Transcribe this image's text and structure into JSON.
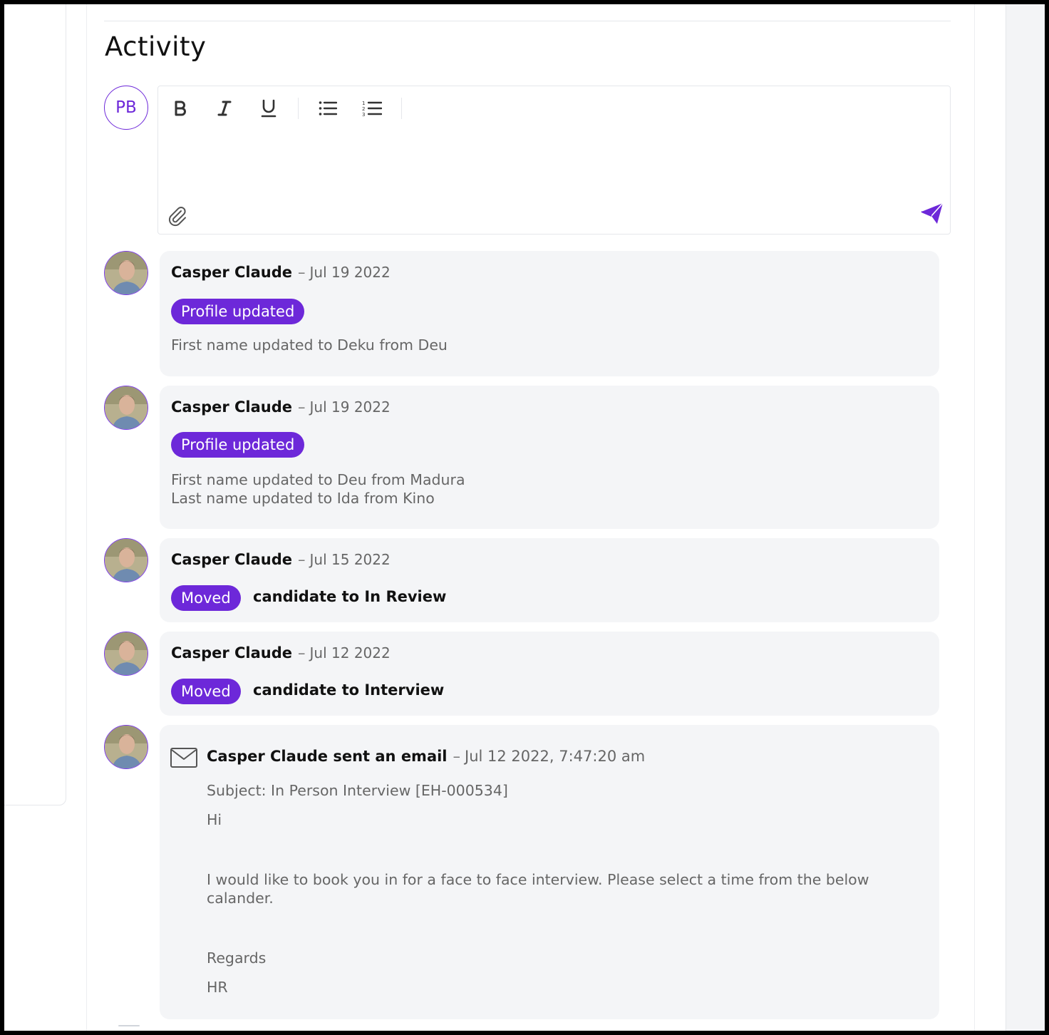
{
  "activity": {
    "title": "Activity",
    "current_user_initials": "PB"
  },
  "editor": {
    "toolbar": [
      "bold-icon",
      "italic-icon",
      "underline-icon",
      "bullet-list-icon",
      "numbered-list-icon"
    ],
    "value": "",
    "placeholder": ""
  },
  "colors": {
    "accent": "#6d28d9",
    "card_bg": "#f4f5f7",
    "muted_text": "#666666"
  },
  "feed": [
    {
      "author": "Casper Claude",
      "date": "Jul 19 2022",
      "tag": "Profile updated",
      "lines": [
        "First name updated to Deku from Deu"
      ]
    },
    {
      "author": "Casper Claude",
      "date": "Jul 19 2022",
      "tag": "Profile updated",
      "lines": [
        "First name updated to Deu from Madura",
        "Last name updated to Ida from Kino"
      ]
    },
    {
      "author": "Casper Claude",
      "date": "Jul 15 2022",
      "tag": "Moved",
      "action": "candidate to In Review"
    },
    {
      "author": "Casper Claude",
      "date": "Jul 12 2022",
      "tag": "Moved",
      "action": "candidate to Interview"
    },
    {
      "author": "Casper Claude sent an email",
      "date": "Jul 12 2022, 7:47:20 am",
      "subject": "Subject: In Person Interview [EH-000534]",
      "body": [
        "Hi",
        "I would like to book you in for a face to face interview. Please select a time from the below calander.",
        "Regards",
        "HR"
      ]
    }
  ]
}
